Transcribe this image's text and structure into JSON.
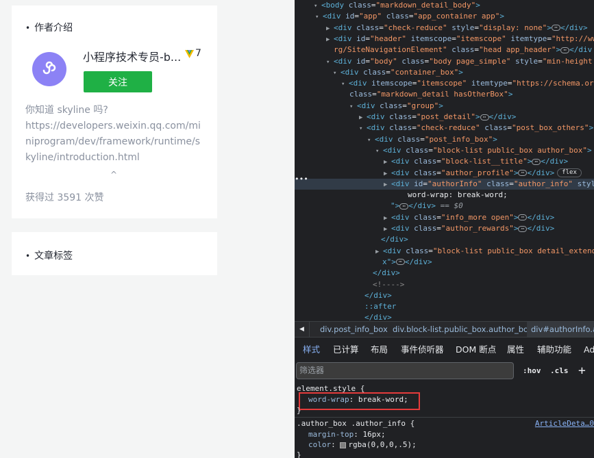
{
  "left": {
    "author_card": {
      "title": "作者介绍",
      "author_name": "小程序技术专员-b...",
      "level": "7",
      "follow_label": "关注",
      "intro": "你知道 skyline 吗? https://developers.weixin.qq.com/miniprogram/dev/framework/runtime/skyline/introduction.html",
      "collapse_glyph": "^",
      "likes": "获得过 3591 次赞"
    },
    "tags_card": {
      "title": "文章标签"
    }
  },
  "devtools": {
    "dom_lines": [
      {
        "indent": 28,
        "tri": "▾",
        "open": "<body",
        "attrs": [
          {
            "n": "class",
            "v": "markdown_detail_body"
          }
        ],
        "close": ">"
      },
      {
        "indent": 30,
        "tri": "▾",
        "open": "<div",
        "attrs": [
          {
            "n": "id",
            "v": "app"
          },
          {
            "n": "class",
            "v": "app_container app"
          }
        ],
        "close": ">"
      },
      {
        "indent": 46,
        "tri": "▶",
        "open": "<div",
        "attrs": [
          {
            "n": "class",
            "v": "check-reduce"
          },
          {
            "n": "style",
            "v": "display: none"
          }
        ],
        "close": ">",
        "ell": true,
        "end": "</div>"
      },
      {
        "indent": 46,
        "tri": "▶",
        "open": "<div",
        "attrs": [
          {
            "n": "id",
            "v": "header"
          },
          {
            "n": "itemscope",
            "v": "itemscope"
          },
          {
            "n": "itemtype",
            "v": "http://ww"
          }
        ],
        "close": ""
      },
      {
        "indent": 57,
        "tri": "",
        "pre": "rg/SiteNavigationElement\"",
        "attrs": [
          {
            "n": "class",
            "v": "head app_header"
          }
        ],
        "close": ">",
        "ell": true,
        "end": "</div"
      },
      {
        "indent": 46,
        "tri": "▾",
        "open": "<div",
        "attrs": [
          {
            "n": "id",
            "v": "body"
          },
          {
            "n": "class",
            "v": "body page_simple"
          },
          {
            "n": "style",
            "v": "min-height:"
          }
        ],
        "close": ""
      },
      {
        "indent": 56,
        "tri": "▾",
        "open": "<div",
        "attrs": [
          {
            "n": "class",
            "v": "container_box"
          }
        ],
        "close": ">"
      },
      {
        "indent": 68,
        "tri": "▾",
        "open": "<div",
        "attrs": [
          {
            "n": "itemscope",
            "v": "itemscope"
          },
          {
            "n": "itemtype",
            "v": "https://schema.org"
          }
        ],
        "close": ""
      },
      {
        "indent": 80,
        "tri": "",
        "pre": "",
        "attrs": [
          {
            "n": "class",
            "v": "markdown_detail hasOtherBox"
          }
        ],
        "close": ">"
      },
      {
        "indent": 80,
        "tri": "▾",
        "open": "<div",
        "attrs": [
          {
            "n": "class",
            "v": "group"
          }
        ],
        "close": ">"
      },
      {
        "indent": 94,
        "tri": "▶",
        "open": "<div",
        "attrs": [
          {
            "n": "class",
            "v": "post_detail"
          }
        ],
        "close": ">",
        "ell": true,
        "end": "</div>"
      },
      {
        "indent": 94,
        "tri": "▾",
        "open": "<div",
        "attrs": [
          {
            "n": "class",
            "v": "check-reduce"
          },
          {
            "n": "class",
            "v": "post_box_others"
          }
        ],
        "close": ">"
      },
      {
        "indent": 106,
        "tri": "▾",
        "open": "<div",
        "attrs": [
          {
            "n": "class",
            "v": "post_info_box"
          }
        ],
        "close": ">"
      },
      {
        "indent": 118,
        "tri": "▾",
        "open": "<div",
        "attrs": [
          {
            "n": "class",
            "v": "block-list public_box author_box"
          }
        ],
        "close": ">"
      },
      {
        "indent": 130,
        "tri": "▶",
        "open": "<div",
        "attrs": [
          {
            "n": "class",
            "v": "block-list__title"
          }
        ],
        "close": ">",
        "ell": true,
        "end": "</div>"
      },
      {
        "indent": 130,
        "tri": "▶",
        "open": "<div",
        "attrs": [
          {
            "n": "class",
            "v": "author_profile"
          }
        ],
        "close": ">",
        "ell": true,
        "end": "</div>",
        "badge": "flex"
      },
      {
        "indent": 130,
        "tri": "▶",
        "open": "<div",
        "attrs": [
          {
            "n": "id",
            "v": "authorInfo"
          },
          {
            "n": "class",
            "v": "author_info"
          },
          {
            "n": "styl",
            "v": ""
          }
        ],
        "close": "",
        "selected": true
      },
      {
        "indent": 165,
        "tri": "",
        "raw": "word-wrap: break-word;",
        "raw_class": "tx"
      },
      {
        "indent": 140,
        "tri": "",
        "raw": "\">",
        "raw_class": "tag",
        "ell": true,
        "end": "</div>",
        "eq": "== $0"
      },
      {
        "indent": 130,
        "tri": "▶",
        "open": "<div",
        "attrs": [
          {
            "n": "class",
            "v": "info_more open"
          }
        ],
        "close": ">",
        "ell": true,
        "end": "</div>"
      },
      {
        "indent": 130,
        "tri": "▶",
        "open": "<div",
        "attrs": [
          {
            "n": "class",
            "v": "author_rewards"
          }
        ],
        "close": ">",
        "ell": true,
        "end": "</div>"
      },
      {
        "indent": 126,
        "tri": "",
        "raw": "</div>",
        "raw_class": "tag"
      },
      {
        "indent": 118,
        "tri": "▶",
        "open": "<div",
        "attrs": [
          {
            "n": "class",
            "v": "block-list public_box detail_extend"
          }
        ],
        "close": ""
      },
      {
        "indent": 128,
        "tri": "",
        "raw": "x\">",
        "raw_class": "tag",
        "ell": true,
        "end": "</div>"
      },
      {
        "indent": 114,
        "tri": "",
        "raw": "</div>",
        "raw_class": "tag"
      },
      {
        "indent": 114,
        "tri": "",
        "raw": "<!---->",
        "raw_class": "cm"
      },
      {
        "indent": 102,
        "tri": "",
        "raw": "</div>",
        "raw_class": "tag"
      },
      {
        "indent": 102,
        "tri": "",
        "raw": "::after",
        "raw_class": "tag"
      },
      {
        "indent": 102,
        "tri": "",
        "raw": "</div>",
        "raw_class": "tag"
      }
    ],
    "gutter_dots": "•••",
    "breadcrumbs": [
      "div.post_info_box",
      "div.block-list.public_box.author_box",
      "div#authorInfo.au"
    ],
    "breadcrumb_arrow": "◀",
    "tabs": [
      "样式",
      "已计算",
      "布局",
      "事件侦听器",
      "DOM 断点",
      "属性",
      "辅助功能",
      "Ad"
    ],
    "filter_placeholder": "筛选器",
    "hov_label": ":hov",
    "cls_label": ".cls",
    "plus_label": "+",
    "styles": {
      "element_selector": "element.style {",
      "element_prop": "word-wrap",
      "element_value": "break-word;",
      "close_brace": "}",
      "rule_selector": ".author_box .author_info {",
      "rule_source": "ArticleDeta…0",
      "rule_props": [
        {
          "name": "margin-top",
          "value": "16px;"
        },
        {
          "name": "color",
          "value": "rgba(0,0,0,.5);"
        }
      ]
    }
  }
}
